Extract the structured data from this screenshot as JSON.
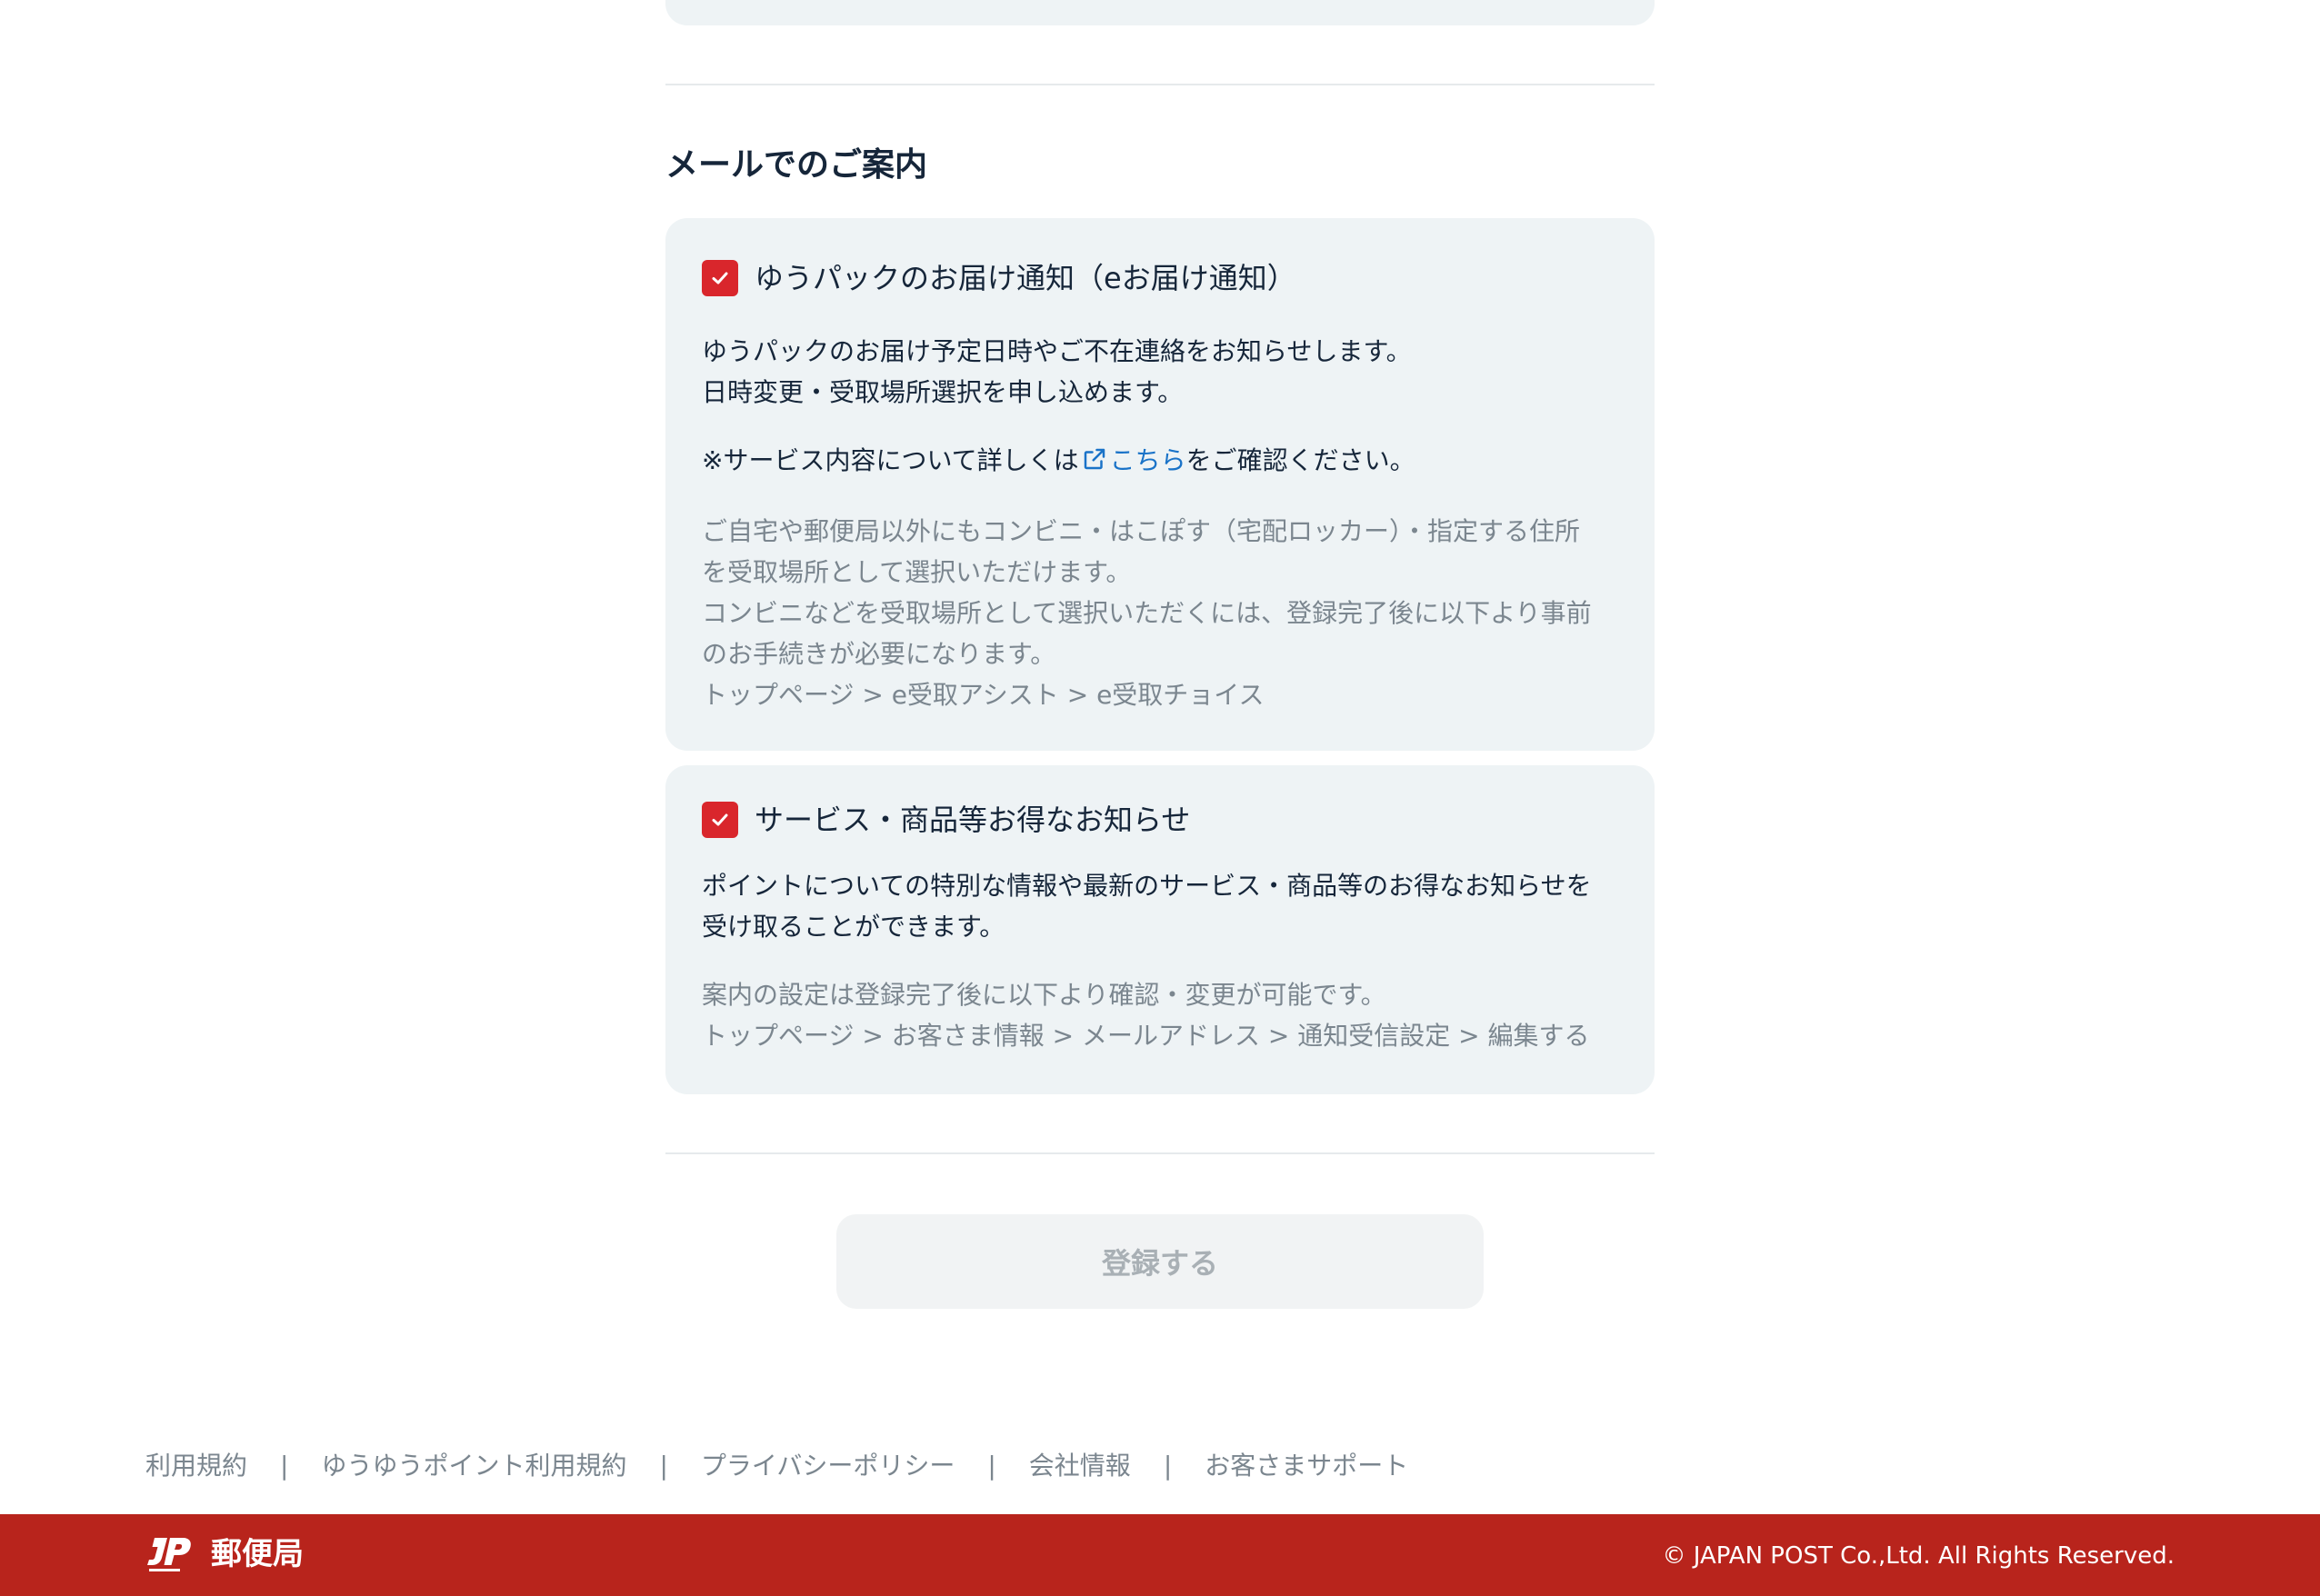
{
  "section": {
    "title": "メールでのご案内"
  },
  "notify_card": {
    "checkbox_label": "ゆうパックのお届け通知（eお届け通知）",
    "checked": true,
    "desc_line1": "ゆうパックのお届け予定日時やご不在連絡をお知らせします。",
    "desc_line2": "日時変更・受取場所選択を申し込めます。",
    "note_prefix": "※サービス内容について詳しくは",
    "note_link": "こちら",
    "note_suffix": "をご確認ください。",
    "muted_line1": "ご自宅や郵便局以外にもコンビニ・はこぽす（宅配ロッカー）・指定する住所",
    "muted_line2": "を受取場所として選択いただけます。",
    "muted_line3": "コンビニなどを受取場所として選択いただくには、登録完了後に以下より事前",
    "muted_line4": "のお手続きが必要になります。",
    "muted_line5": "トップページ > e受取アシスト > e受取チョイス"
  },
  "promo_card": {
    "checkbox_label": "サービス・商品等お得なお知らせ",
    "checked": true,
    "desc_line1": "ポイントについての特別な情報や最新のサービス・商品等のお得なお知らせを",
    "desc_line2": "受け取ることができます。",
    "muted_line1": "案内の設定は登録完了後に以下より確認・変更が可能です。",
    "muted_line2": "トップページ > お客さま情報 > メールアドレス > 通知受信設定 > 編集する"
  },
  "submit": {
    "label": "登録する",
    "disabled": true
  },
  "footer": {
    "links": [
      "利用規約",
      "ゆうゆうポイント利用規約",
      "プライバシーポリシー",
      "会社情報",
      "お客さまサポート"
    ],
    "separator": "|",
    "logo_text": "郵便局",
    "copyright": "© JAPAN POST Co.,Ltd. All Rights Reserved."
  },
  "colors": {
    "accent_red": "#d9262c",
    "footer_red": "#b8241c",
    "link_blue": "#1a73c8",
    "card_bg": "#eef3f5"
  },
  "icons": {
    "checkbox": "check-icon",
    "external_link": "external-link-icon",
    "logo": "jp-post-logo"
  }
}
